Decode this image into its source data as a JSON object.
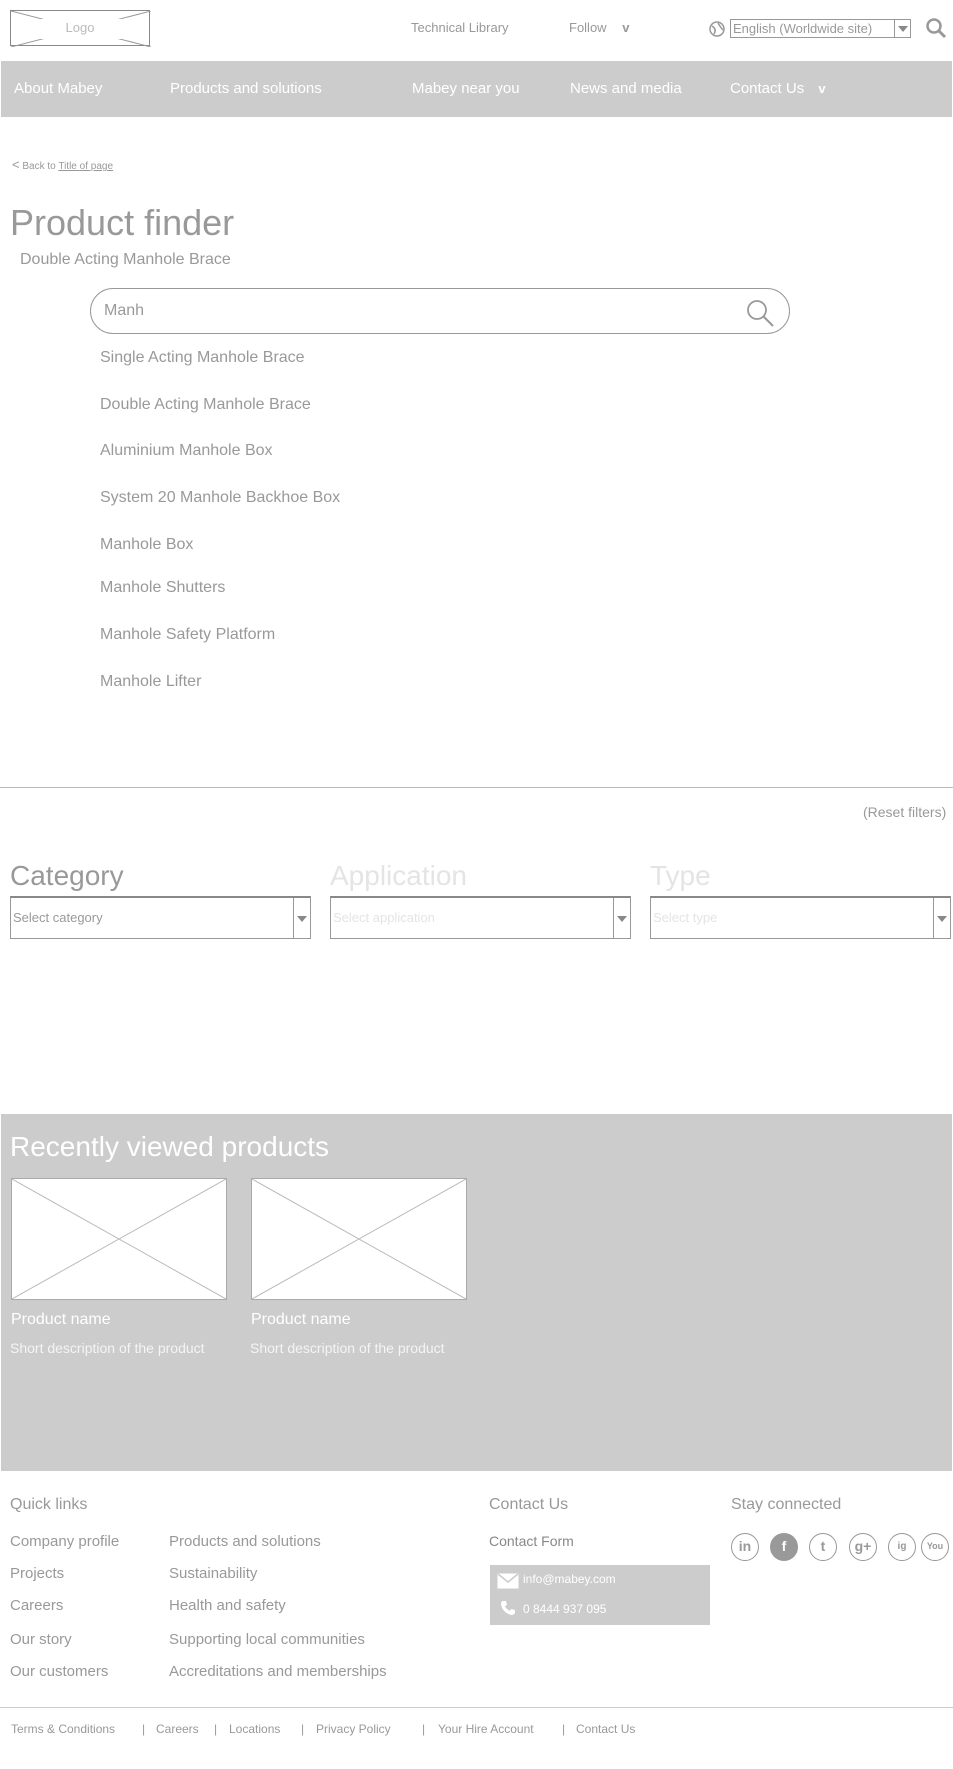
{
  "header": {
    "logo_text": "Logo",
    "technical_library": "Technical Library",
    "follow": "Follow",
    "follow_chevron": "v",
    "language_value": "English (Worldwide site)"
  },
  "nav": {
    "items": [
      "About Mabey",
      "Products and solutions",
      "Mabey near you",
      "News and media",
      "Contact Us"
    ],
    "contact_chevron": "v"
  },
  "breadcrumb": {
    "arrow": "<",
    "prefix": "Back to",
    "link": "Title of page"
  },
  "page": {
    "title": "Product finder",
    "subtitle": "Double Acting Manhole Brace"
  },
  "search": {
    "value": "Manh",
    "suggestions": [
      "Single Acting Manhole Brace",
      "Double Acting Manhole Brace",
      "Aluminium Manhole Box",
      "System 20 Manhole Backhoe Box",
      "Manhole Box",
      "Manhole Shutters",
      "Manhole Safety Platform",
      "Manhole Lifter"
    ]
  },
  "filters": {
    "reset": "(Reset filters)",
    "category": {
      "label": "Category",
      "placeholder": "Select category"
    },
    "application": {
      "label": "Application",
      "placeholder": "Select application"
    },
    "type": {
      "label": "Type",
      "placeholder": "Select type"
    }
  },
  "recent": {
    "title": "Recently viewed products",
    "products": [
      {
        "name": "Product name",
        "description": "Short description of the product"
      },
      {
        "name": "Product name",
        "description": "Short description of the product"
      }
    ]
  },
  "footer": {
    "quick_links_title": "Quick links",
    "quick_links_col1": [
      "Company profile",
      "Projects",
      "Careers",
      "Our story",
      "Our customers"
    ],
    "quick_links_col2": [
      "Products and solutions",
      "Sustainability",
      "Health and safety",
      "Supporting local communities",
      "Accreditations and memberships"
    ],
    "contact_title": "Contact Us",
    "contact_form": "Contact Form",
    "email": "info@mabey.com",
    "phone": "0 8444 937 095",
    "stay_connected_title": "Stay connected",
    "social": [
      "linkedin-icon",
      "facebook-icon",
      "twitter-icon",
      "google-plus-icon",
      "instagram-icon",
      "youtube-icon"
    ],
    "social_glyphs": [
      "in",
      "f",
      "t",
      "g+",
      "ig",
      "You"
    ],
    "bottom_links": [
      "Terms & Conditions",
      "Careers",
      "Locations",
      "Privacy Policy",
      "Your Hire Account",
      "Contact Us"
    ],
    "separator": "|"
  },
  "colors": {
    "nav_bg": "#cccccc",
    "text_gray": "#999999",
    "white": "#ffffff"
  }
}
